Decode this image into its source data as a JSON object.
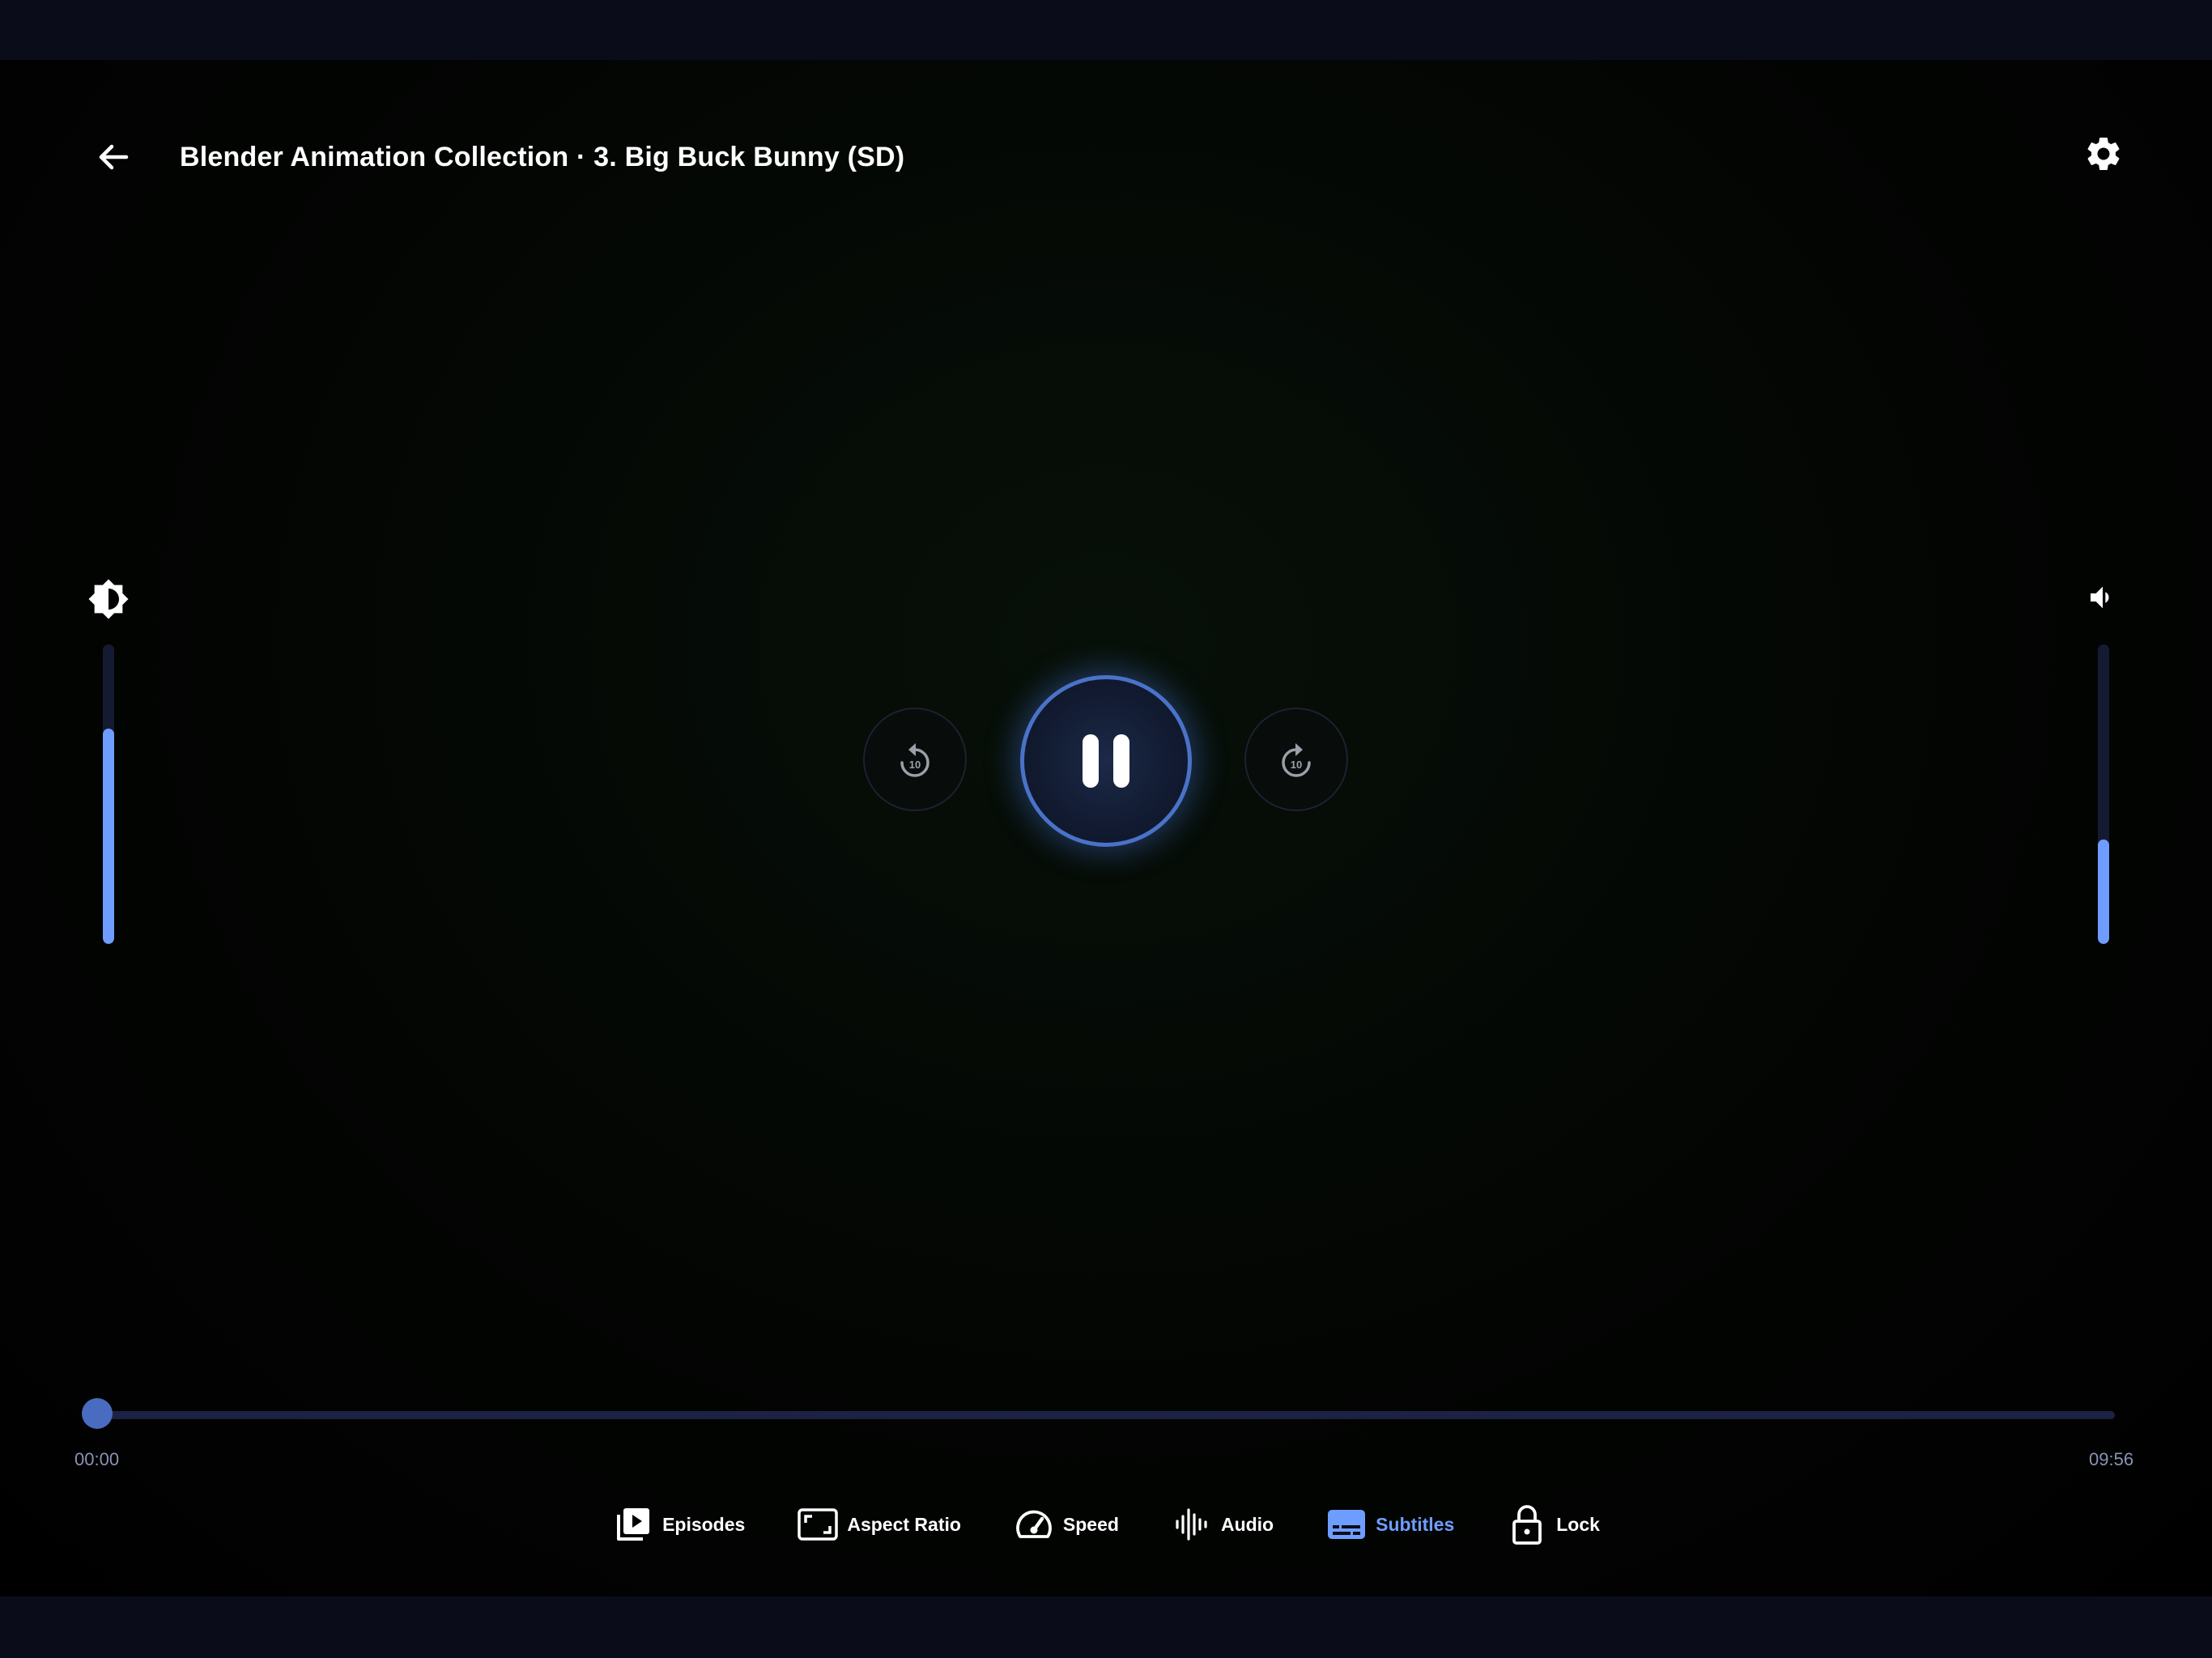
{
  "header": {
    "title": "Blender Animation Collection · 3. Big Buck Bunny (SD)",
    "back_icon": "arrow-left-icon",
    "settings_icon": "gear-icon"
  },
  "brightness": {
    "icon": "brightness-icon",
    "level": 0.72
  },
  "volume": {
    "icon": "speaker-icon",
    "level": 0.35
  },
  "controls": {
    "rewind_label": "10",
    "forward_label": "10",
    "state": "playing",
    "rewind_icon": "rewind-10-icon",
    "forward_icon": "forward-10-icon",
    "pause_icon": "pause-icon"
  },
  "progress": {
    "current": "00:00",
    "duration": "09:56",
    "fraction": 0.0
  },
  "toolbar": {
    "items": [
      {
        "label": "Episodes",
        "icon": "episodes-icon",
        "active": false
      },
      {
        "label": "Aspect Ratio",
        "icon": "aspect-ratio-icon",
        "active": false
      },
      {
        "label": "Speed",
        "icon": "speed-icon",
        "active": false
      },
      {
        "label": "Audio",
        "icon": "audio-icon",
        "active": false
      },
      {
        "label": "Subtitles",
        "icon": "subtitles-icon",
        "active": true
      },
      {
        "label": "Lock",
        "icon": "lock-icon",
        "active": false
      }
    ]
  },
  "colors": {
    "accent": "#6f9dff",
    "progress": "#4a6cc0",
    "track": "#1c2244",
    "background": "#000000"
  }
}
